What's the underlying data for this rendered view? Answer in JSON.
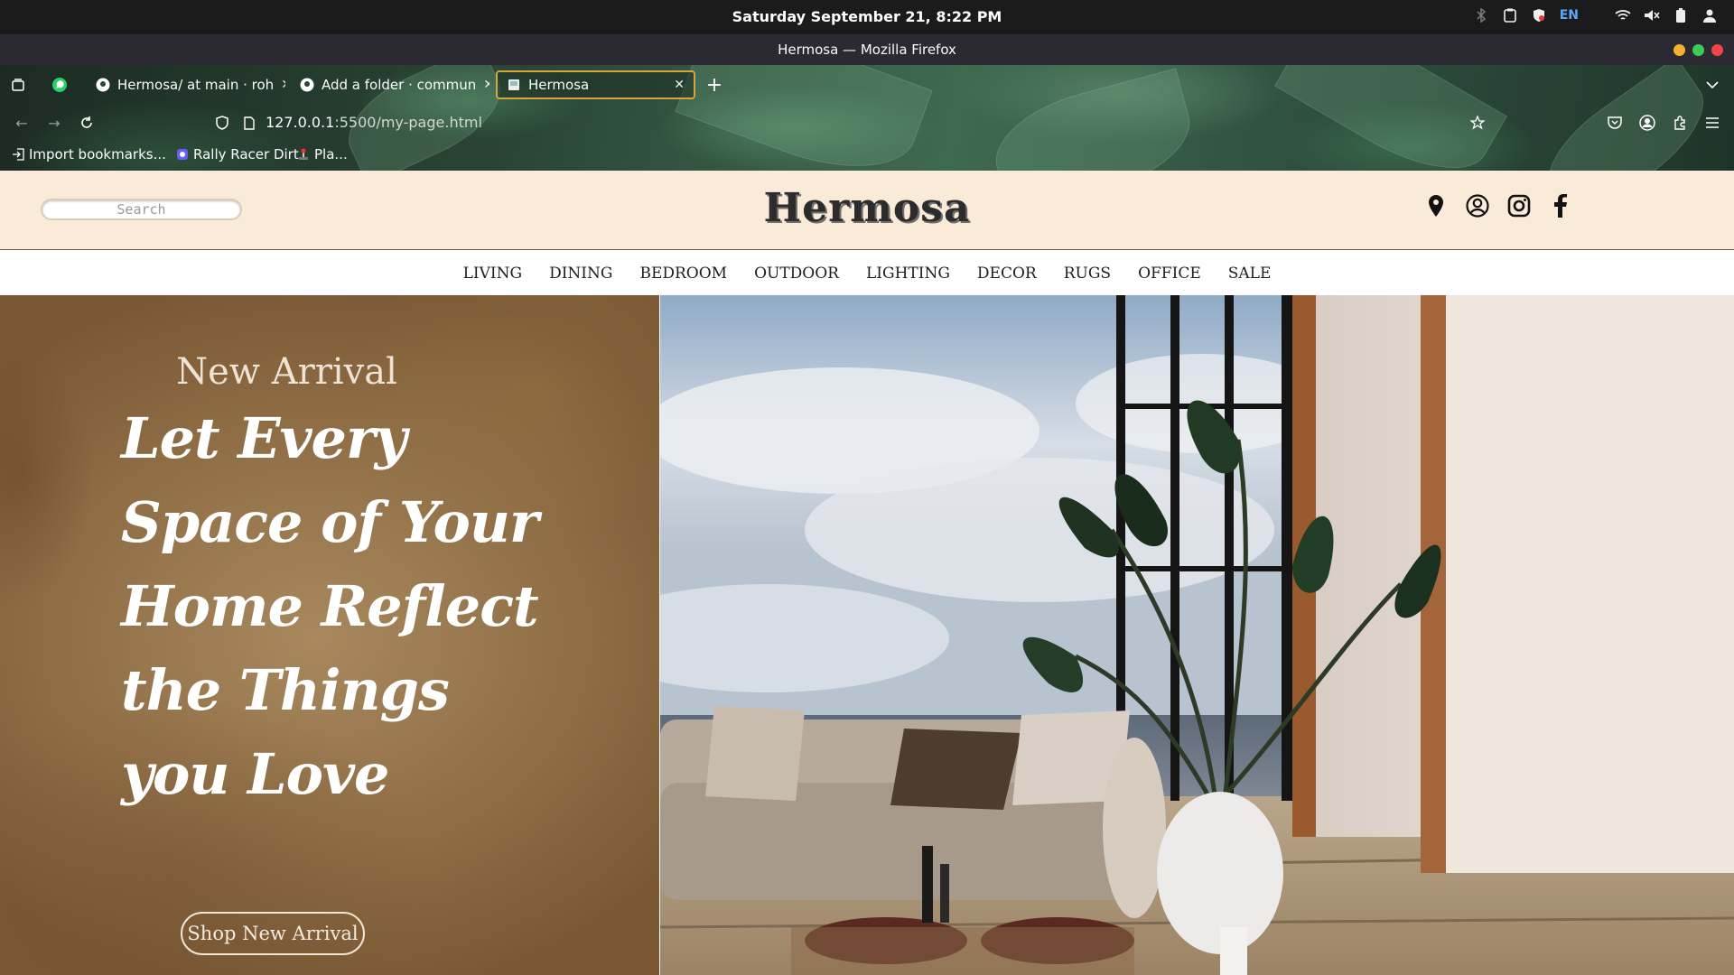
{
  "os": {
    "clock": "Saturday September 21,  8:22 PM",
    "lang": "EN"
  },
  "window": {
    "title": "Hermosa — Mozilla Firefox"
  },
  "tabs": [
    {
      "label": "Hermosa/ at main · roh"
    },
    {
      "label": "Add a folder · commun"
    },
    {
      "label": "Hermosa"
    }
  ],
  "address": {
    "host": "127.0.0.1",
    "path": ":5500/my-page.html"
  },
  "bookmarks": [
    {
      "label": "Import bookmarks..."
    },
    {
      "label": "Rally Racer Dirt"
    },
    {
      "label": "Pla..."
    }
  ],
  "site": {
    "search_placeholder": "Search",
    "logo": "Hermosa",
    "nav": [
      "LIVING",
      "DINING",
      "BEDROOM",
      "OUTDOOR",
      "LIGHTING",
      "DECOR",
      "RUGS",
      "OFFICE",
      "SALE"
    ],
    "hero": {
      "label": "New Arrival",
      "headline": "Let Every Space of Your Home Reflect the Things you Love",
      "button": "Shop New Arrival"
    }
  }
}
